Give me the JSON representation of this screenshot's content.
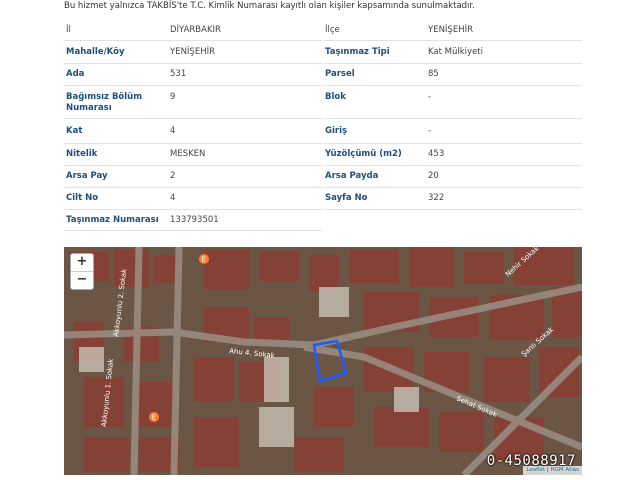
{
  "notice": "Bu hizmet yalnızca TAKBİS'te T.C. Kimlik Numarası kayıtlı olan kişiler kapsamında sunulmaktadır.",
  "fields": {
    "il_label": "İl",
    "il_value": "DİYARBAKIR",
    "ilce_label": "İlçe",
    "ilce_value": "YENİŞEHİR",
    "mahalle_label": "Mahalle/Köy",
    "mahalle_value": "YENİŞEHİR",
    "tasinmaz_tipi_label": "Taşınmaz Tipi",
    "tasinmaz_tipi_value": "Kat Mülkiyeti",
    "ada_label": "Ada",
    "ada_value": "531",
    "parsel_label": "Parsel",
    "parsel_value": "85",
    "bbn_label": "Bağımsız Bölüm Numarası",
    "bbn_value": "9",
    "blok_label": "Blok",
    "blok_value": "-",
    "kat_label": "Kat",
    "kat_value": "4",
    "giris_label": "Giriş",
    "giris_value": "-",
    "nitelik_label": "Nitelik",
    "nitelik_value": "MESKEN",
    "yuzolcumu_label": "Yüzölçümü (m2)",
    "yuzolcumu_value": "453",
    "arsa_pay_label": "Arsa Pay",
    "arsa_pay_value": "2",
    "arsa_payda_label": "Arsa Payda",
    "arsa_payda_value": "20",
    "cilt_label": "Cilt No",
    "cilt_value": "4",
    "sayfa_label": "Sayfa No",
    "sayfa_value": "322",
    "tasinmaz_no_label": "Taşınmaz Numarası",
    "tasinmaz_no_value": "133793501"
  },
  "map": {
    "zoom_in": "+",
    "zoom_out": "−",
    "street_1": "Akkoyunlu 2. Sokak",
    "street_2": "Akkoyunlu 1. Sokak",
    "street_3": "Ahu 4. Sokak",
    "street_4": "Şanlı Sokak",
    "street_5": "Nehir Sokak",
    "street_6": "Sehat Sokak",
    "attrib_leaflet": "Leaflet",
    "attrib_sep": " | ",
    "attrib_hgm": "HGM Atlas",
    "map_id": "0-45088917",
    "accent": "#1e5cff"
  }
}
